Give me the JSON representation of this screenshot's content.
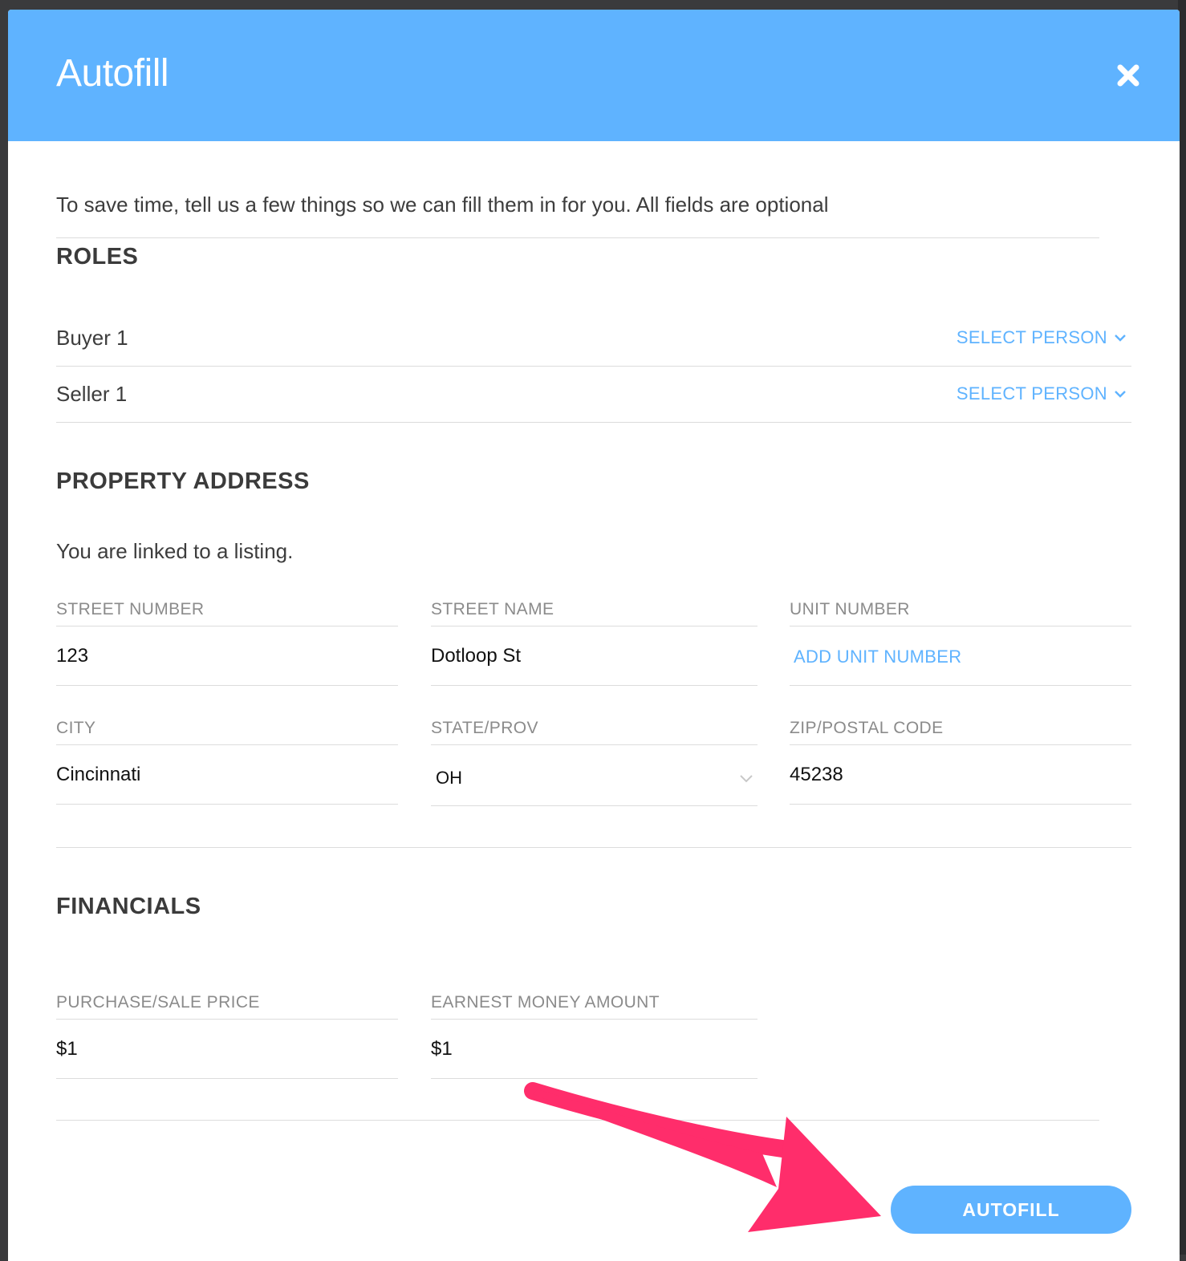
{
  "modal": {
    "title": "Autofill",
    "intro": "To save time, tell us a few things so we can fill them in for you. All fields are optional"
  },
  "roles": {
    "heading": "ROLES",
    "items": [
      {
        "label": "Buyer 1",
        "action": "SELECT PERSON"
      },
      {
        "label": "Seller 1",
        "action": "SELECT PERSON"
      }
    ]
  },
  "property": {
    "heading": "PROPERTY ADDRESS",
    "linked_note": "You are linked to a listing.",
    "street_number": {
      "label": "STREET NUMBER",
      "value": "123"
    },
    "street_name": {
      "label": "STREET NAME",
      "value": "Dotloop St"
    },
    "unit_number": {
      "label": "UNIT NUMBER",
      "action": "ADD UNIT NUMBER"
    },
    "city": {
      "label": "CITY",
      "value": "Cincinnati"
    },
    "state": {
      "label": "STATE/PROV",
      "value": "OH"
    },
    "zip": {
      "label": "ZIP/POSTAL CODE",
      "value": "45238"
    }
  },
  "financials": {
    "heading": "FINANCIALS",
    "purchase_price": {
      "label": "PURCHASE/SALE PRICE",
      "value": "$1"
    },
    "earnest_money": {
      "label": "EARNEST MONEY AMOUNT",
      "value": "$1"
    }
  },
  "footer": {
    "autofill_label": "AUTOFILL"
  },
  "colors": {
    "header": "#5fb3ff",
    "accent": "#5fb3ff",
    "annotation_arrow": "#ff2d6b"
  },
  "icons": [
    "close-icon",
    "chevron-down-icon",
    "annotation-arrow"
  ]
}
